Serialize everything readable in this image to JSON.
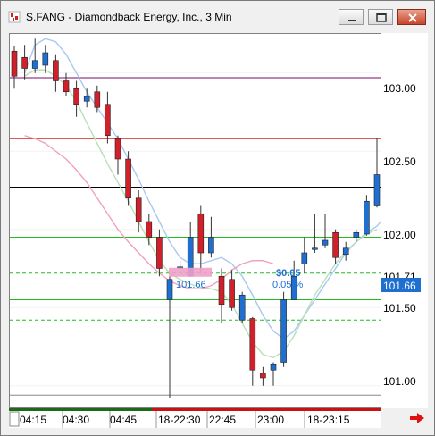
{
  "window": {
    "title": "S.FANG - Diamondback Energy, Inc., 3 Min"
  },
  "colors": {
    "up_candle": "#1f6fd0",
    "down_candle": "#d0202a",
    "current_price_badge": "#1f6fd0",
    "upper_band": "#7a0a6a",
    "pink_average": "#f0a0c0",
    "blue_average": "#a8c8f0",
    "green_average": "#b8e0b8",
    "level_green": "#22bb22",
    "level_red": "#cc2222"
  },
  "price_axis": {
    "ticks": [
      "103.00",
      "102.50",
      "102.00",
      "101.71",
      "101.50",
      "101.00"
    ],
    "current_price": "101.66"
  },
  "time_axis": {
    "ticks": [
      "04:15",
      "04:30",
      "04:45",
      "18-22:30",
      "22:45",
      "23:00",
      "18-23:15"
    ]
  },
  "annotation": {
    "change_value": "$0.05",
    "change_percent": "0.05 %",
    "selection_price": "101.66"
  },
  "chart_data": {
    "type": "candlestick",
    "title": "S.FANG - Diamondback Energy, Inc., 3 Min",
    "ylim": [
      100.85,
      103.25
    ],
    "x": [
      "04:06",
      "04:09",
      "04:12",
      "04:15",
      "04:18",
      "04:21",
      "04:24",
      "04:27",
      "04:30",
      "04:33",
      "04:36",
      "04:39",
      "04:42",
      "04:45",
      "04:48",
      "04:51",
      "04:54",
      "04:57",
      "18-22:30",
      "22:33",
      "22:36",
      "22:39",
      "22:42",
      "22:45",
      "22:48",
      "22:51",
      "22:54",
      "22:57",
      "23:00",
      "23:03",
      "23:06",
      "23:09",
      "23:12",
      "23:15",
      "23:18",
      "23:21"
    ],
    "candles": [
      {
        "o": 103.14,
        "h": 103.17,
        "l": 102.9,
        "c": 102.98
      },
      {
        "o": 103.1,
        "h": 103.18,
        "l": 102.96,
        "c": 103.03
      },
      {
        "o": 103.03,
        "h": 103.22,
        "l": 103.0,
        "c": 103.08
      },
      {
        "o": 103.05,
        "h": 103.18,
        "l": 103.0,
        "c": 103.13
      },
      {
        "o": 103.08,
        "h": 103.12,
        "l": 102.88,
        "c": 102.95
      },
      {
        "o": 102.95,
        "h": 103.0,
        "l": 102.85,
        "c": 102.88
      },
      {
        "o": 102.9,
        "h": 102.95,
        "l": 102.72,
        "c": 102.8
      },
      {
        "o": 102.82,
        "h": 102.9,
        "l": 102.78,
        "c": 102.85
      },
      {
        "o": 102.88,
        "h": 102.92,
        "l": 102.75,
        "c": 102.78
      },
      {
        "o": 102.8,
        "h": 102.88,
        "l": 102.55,
        "c": 102.6
      },
      {
        "o": 102.58,
        "h": 102.6,
        "l": 102.35,
        "c": 102.45
      },
      {
        "o": 102.45,
        "h": 102.5,
        "l": 102.15,
        "c": 102.2
      },
      {
        "o": 102.2,
        "h": 102.25,
        "l": 101.98,
        "c": 102.05
      },
      {
        "o": 102.05,
        "h": 102.1,
        "l": 101.9,
        "c": 101.95
      },
      {
        "o": 101.95,
        "h": 102.0,
        "l": 101.7,
        "c": 101.75
      },
      {
        "o": 101.55,
        "h": 101.7,
        "l": 100.92,
        "c": 101.68
      },
      {
        "o": 101.75,
        "h": 101.8,
        "l": 101.75,
        "c": 101.76
      },
      {
        "o": 101.7,
        "h": 102.05,
        "l": 101.7,
        "c": 101.95
      },
      {
        "o": 102.1,
        "h": 102.15,
        "l": 101.72,
        "c": 101.85
      },
      {
        "o": 101.85,
        "h": 102.08,
        "l": 101.82,
        "c": 101.95
      },
      {
        "o": 101.7,
        "h": 101.75,
        "l": 101.4,
        "c": 101.52
      },
      {
        "o": 101.68,
        "h": 101.74,
        "l": 101.48,
        "c": 101.5
      },
      {
        "o": 101.42,
        "h": 101.6,
        "l": 101.4,
        "c": 101.58
      },
      {
        "o": 101.43,
        "h": 101.44,
        "l": 101.0,
        "c": 101.1
      },
      {
        "o": 101.08,
        "h": 101.12,
        "l": 101.0,
        "c": 101.05
      },
      {
        "o": 101.1,
        "h": 101.15,
        "l": 101.0,
        "c": 101.14
      },
      {
        "o": 101.15,
        "h": 101.6,
        "l": 101.12,
        "c": 101.55
      },
      {
        "o": 101.55,
        "h": 101.8,
        "l": 101.55,
        "c": 101.7
      },
      {
        "o": 101.78,
        "h": 101.95,
        "l": 101.72,
        "c": 101.85
      },
      {
        "o": 101.88,
        "h": 102.1,
        "l": 101.85,
        "c": 101.88
      },
      {
        "o": 101.9,
        "h": 102.1,
        "l": 101.88,
        "c": 101.93
      },
      {
        "o": 101.98,
        "h": 102.0,
        "l": 101.78,
        "c": 101.82
      },
      {
        "o": 101.84,
        "h": 101.92,
        "l": 101.8,
        "c": 101.88
      },
      {
        "o": 101.95,
        "h": 102.0,
        "l": 101.92,
        "c": 101.98
      },
      {
        "o": 101.97,
        "h": 102.22,
        "l": 101.96,
        "c": 102.18
      },
      {
        "o": 102.15,
        "h": 102.58,
        "l": 102.14,
        "c": 102.35
      },
      {
        "o": 102.35,
        "h": 102.55,
        "l": 102.33,
        "c": 102.5
      }
    ],
    "levels": [
      {
        "price": 102.97,
        "color": "#7a0a6a"
      },
      {
        "price": 102.58,
        "color": "#cc2222"
      },
      {
        "price": 102.27,
        "color": "#000000"
      },
      {
        "price": 101.95,
        "color": "#22bb22"
      },
      {
        "price": 101.72,
        "color": "#22bb22",
        "dashed": true
      },
      {
        "price": 101.55,
        "color": "#22bb22"
      },
      {
        "price": 101.42,
        "color": "#22bb22",
        "dashed": true
      },
      {
        "price": 100.94,
        "color": "#888888"
      }
    ],
    "series": [
      {
        "color": "#a8c8f0",
        "values": [
          103.0,
          103.18,
          103.22,
          103.2,
          103.12,
          103.0,
          102.88,
          102.78,
          102.68,
          102.58,
          102.45,
          102.32,
          102.18,
          102.05,
          101.92,
          101.82,
          101.78,
          101.78,
          101.8,
          101.82,
          101.78,
          101.7,
          101.58,
          101.45,
          101.35,
          101.3,
          101.35,
          101.45,
          101.55,
          101.65,
          101.75,
          101.85,
          101.92,
          101.98,
          102.02,
          102.1,
          102.22
        ]
      },
      {
        "color": "#b8e0b8",
        "values": [
          102.98,
          103.02,
          103.02,
          102.98,
          102.92,
          102.82,
          102.68,
          102.55,
          102.42,
          102.3,
          102.18,
          102.05,
          101.92,
          101.8,
          101.72,
          101.68,
          101.65,
          101.63,
          101.62,
          101.6,
          101.52,
          101.4,
          101.28,
          101.2,
          101.18,
          101.22,
          101.32,
          101.45,
          101.58,
          101.68,
          101.78,
          101.86,
          101.92,
          101.97,
          102.0
        ]
      },
      {
        "color": "#f0a0c0",
        "values": [
          102.6,
          102.58,
          102.55,
          102.5,
          102.45,
          102.38,
          102.3,
          102.2,
          102.1,
          102.0,
          101.92,
          101.85,
          101.78,
          101.72,
          101.67,
          101.64,
          101.62,
          101.62,
          101.64,
          101.68,
          101.74,
          101.78,
          101.8,
          101.8,
          101.78
        ]
      }
    ]
  }
}
